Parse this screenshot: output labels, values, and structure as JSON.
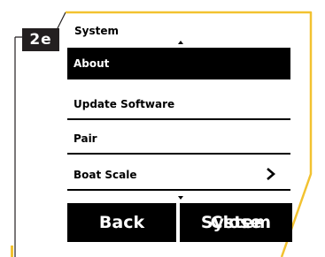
{
  "step_badge": "2e",
  "screen": {
    "title": "System",
    "menu": [
      {
        "label": "About",
        "selected": true
      },
      {
        "label": "Update Software",
        "selected": false
      },
      {
        "label": "Pair",
        "selected": false
      },
      {
        "label": "Boat Scale",
        "selected": false,
        "has_submenu": true
      }
    ],
    "softkeys": {
      "left": "Back",
      "right_overlapping": [
        "System",
        "Close"
      ]
    }
  },
  "colors": {
    "frame_accent": "#f2c230",
    "frame_line": "#231f20",
    "screen_bg": "#ffffff",
    "selection_bg": "#000000",
    "softkey_bg": "#000000"
  },
  "icons": [
    "scroll-up-arrow-icon",
    "scroll-down-arrow-icon",
    "chevron-right-icon"
  ]
}
